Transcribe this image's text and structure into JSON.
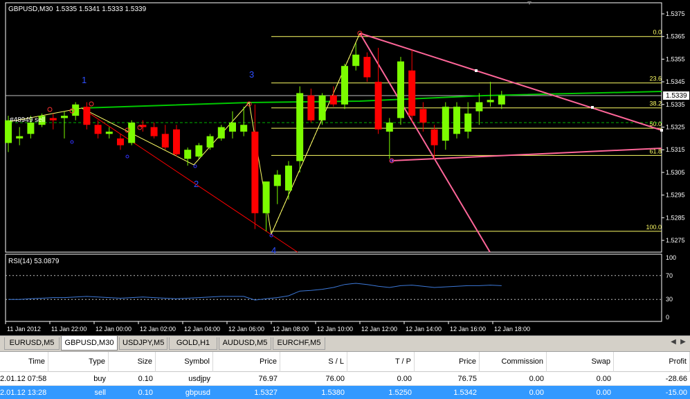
{
  "chart": {
    "symbol_label": "GBPUSD,M30",
    "ohlc_label": "1.5335 1.5341 1.5333 1.5339",
    "order_label": "#48949 sell",
    "current_price_label": "1.5339",
    "wave_labels": [
      "1",
      "3",
      "2",
      "4"
    ],
    "price_axis": [
      "1.5375",
      "1.5365",
      "1.5355",
      "1.5345",
      "1.5335",
      "1.5325",
      "1.5315",
      "1.5305",
      "1.5295",
      "1.5285",
      "1.5275"
    ],
    "time_axis": [
      "11 Jan 2012",
      "11 Jan 22:00",
      "12 Jan 00:00",
      "12 Jan 02:00",
      "12 Jan 04:00",
      "12 Jan 06:00",
      "12 Jan 08:00",
      "12 Jan 10:00",
      "12 Jan 12:00",
      "12 Jan 14:00",
      "12 Jan 16:00",
      "12 Jan 18:00"
    ],
    "fib_levels": [
      {
        "label": "0.0",
        "price": 1.5365
      },
      {
        "label": "23.6",
        "price": 1.53445
      },
      {
        "label": "38.2",
        "price": 1.53335
      },
      {
        "label": "50.0",
        "price": 1.53245
      },
      {
        "label": "61.8",
        "price": 1.53125
      },
      {
        "label": "100.0",
        "price": 1.5279
      }
    ],
    "rsi": {
      "label": "RSI(14) 53.0879",
      "axis": [
        "100",
        "70",
        "30",
        "0"
      ]
    },
    "colors": {
      "bull": "#7cfc00",
      "bear": "#ff0000",
      "fib": "#ffff66",
      "trend_green": "#00c800",
      "trend_pink": "#ff6699",
      "rsi_line": "#3c78d8"
    }
  },
  "tabs": [
    "EURUSD,M5",
    "GBPUSD,M30",
    "USDJPY,M5",
    "GOLD,H1",
    "AUDUSD,M5",
    "EURCHF,M5"
  ],
  "active_tab": "GBPUSD,M30",
  "trades": {
    "columns": [
      "Time",
      "Type",
      "Size",
      "Symbol",
      "Price",
      "S / L",
      "T / P",
      "Price",
      "Commission",
      "Swap",
      "Profit"
    ],
    "rows": [
      [
        "2.01.12 07:58",
        "buy",
        "0.10",
        "usdjpy",
        "76.97",
        "76.00",
        "0.00",
        "76.75",
        "0.00",
        "0.00",
        "-28.66"
      ],
      [
        "2.01.12 13:28",
        "sell",
        "0.10",
        "gbpusd",
        "1.5327",
        "1.5380",
        "1.5250",
        "1.5342",
        "0.00",
        "0.00",
        "-15.00"
      ]
    ]
  },
  "chart_data": {
    "type": "candlestick",
    "symbol": "GBPUSD,M30",
    "candles": [
      {
        "o": 1.5318,
        "h": 1.533,
        "l": 1.5314,
        "c": 1.5328
      },
      {
        "o": 1.532,
        "h": 1.5325,
        "l": 1.5317,
        "c": 1.5321
      },
      {
        "o": 1.5322,
        "h": 1.533,
        "l": 1.532,
        "c": 1.5327
      },
      {
        "o": 1.5326,
        "h": 1.5331,
        "l": 1.5325,
        "c": 1.533
      },
      {
        "o": 1.5329,
        "h": 1.5331,
        "l": 1.5324,
        "c": 1.5328
      },
      {
        "o": 1.5329,
        "h": 1.5332,
        "l": 1.532,
        "c": 1.533
      },
      {
        "o": 1.533,
        "h": 1.5336,
        "l": 1.5328,
        "c": 1.5335
      },
      {
        "o": 1.5334,
        "h": 1.5336,
        "l": 1.5324,
        "c": 1.5326
      },
      {
        "o": 1.5326,
        "h": 1.5328,
        "l": 1.532,
        "c": 1.5322
      },
      {
        "o": 1.5322,
        "h": 1.5325,
        "l": 1.532,
        "c": 1.5323
      },
      {
        "o": 1.532,
        "h": 1.5322,
        "l": 1.5315,
        "c": 1.5317
      },
      {
        "o": 1.5318,
        "h": 1.5328,
        "l": 1.5317,
        "c": 1.5327
      },
      {
        "o": 1.5326,
        "h": 1.5328,
        "l": 1.5323,
        "c": 1.5325
      },
      {
        "o": 1.5325,
        "h": 1.5327,
        "l": 1.532,
        "c": 1.5321
      },
      {
        "o": 1.5322,
        "h": 1.5326,
        "l": 1.5315,
        "c": 1.5316
      },
      {
        "o": 1.5324,
        "h": 1.5326,
        "l": 1.5312,
        "c": 1.5313
      },
      {
        "o": 1.5311,
        "h": 1.5316,
        "l": 1.5308,
        "c": 1.5315
      },
      {
        "o": 1.5312,
        "h": 1.5318,
        "l": 1.5311,
        "c": 1.5317
      },
      {
        "o": 1.5316,
        "h": 1.5322,
        "l": 1.5315,
        "c": 1.5321
      },
      {
        "o": 1.532,
        "h": 1.5326,
        "l": 1.5319,
        "c": 1.5325
      },
      {
        "o": 1.5323,
        "h": 1.5332,
        "l": 1.532,
        "c": 1.5327
      },
      {
        "o": 1.5323,
        "h": 1.5334,
        "l": 1.5321,
        "c": 1.5326
      },
      {
        "o": 1.5323,
        "h": 1.5335,
        "l": 1.528,
        "c": 1.5287
      },
      {
        "o": 1.5287,
        "h": 1.5301,
        "l": 1.5279,
        "c": 1.5301
      },
      {
        "o": 1.5299,
        "h": 1.5306,
        "l": 1.5291,
        "c": 1.5304
      },
      {
        "o": 1.5297,
        "h": 1.531,
        "l": 1.5293,
        "c": 1.5308
      },
      {
        "o": 1.531,
        "h": 1.5343,
        "l": 1.5305,
        "c": 1.534
      },
      {
        "o": 1.5339,
        "h": 1.5342,
        "l": 1.5327,
        "c": 1.5328
      },
      {
        "o": 1.5328,
        "h": 1.534,
        "l": 1.5326,
        "c": 1.5339
      },
      {
        "o": 1.5339,
        "h": 1.5343,
        "l": 1.5334,
        "c": 1.5335
      },
      {
        "o": 1.5335,
        "h": 1.5353,
        "l": 1.5333,
        "c": 1.5352
      },
      {
        "o": 1.5352,
        "h": 1.5362,
        "l": 1.535,
        "c": 1.5357
      },
      {
        "o": 1.5356,
        "h": 1.5358,
        "l": 1.5345,
        "c": 1.5347
      },
      {
        "o": 1.5345,
        "h": 1.536,
        "l": 1.5322,
        "c": 1.5324
      },
      {
        "o": 1.5323,
        "h": 1.5329,
        "l": 1.5311,
        "c": 1.5327
      },
      {
        "o": 1.5329,
        "h": 1.5356,
        "l": 1.5326,
        "c": 1.5354
      },
      {
        "o": 1.535,
        "h": 1.5359,
        "l": 1.5327,
        "c": 1.533
      },
      {
        "o": 1.5333,
        "h": 1.5336,
        "l": 1.5323,
        "c": 1.5327
      },
      {
        "o": 1.5324,
        "h": 1.5326,
        "l": 1.5311,
        "c": 1.5317
      },
      {
        "o": 1.5319,
        "h": 1.5336,
        "l": 1.5315,
        "c": 1.5334
      },
      {
        "o": 1.5322,
        "h": 1.5336,
        "l": 1.532,
        "c": 1.5334
      },
      {
        "o": 1.5323,
        "h": 1.5336,
        "l": 1.532,
        "c": 1.5331
      },
      {
        "o": 1.5332,
        "h": 1.534,
        "l": 1.5326,
        "c": 1.5336
      },
      {
        "o": 1.5336,
        "h": 1.5345,
        "l": 1.5334,
        "c": 1.5337
      },
      {
        "o": 1.5335,
        "h": 1.5341,
        "l": 1.5333,
        "c": 1.5339
      }
    ],
    "ylim": [
      1.527,
      1.538
    ],
    "rsi_values": [
      30,
      30,
      31,
      32,
      33,
      33,
      34,
      35,
      34,
      33,
      32,
      33,
      34,
      33,
      32,
      31,
      32,
      33,
      34,
      35,
      35,
      35,
      29,
      31,
      33,
      36,
      44,
      45,
      47,
      50,
      55,
      57,
      55,
      52,
      50,
      53,
      54,
      52,
      50,
      51,
      52,
      53,
      53,
      54,
      53
    ]
  }
}
